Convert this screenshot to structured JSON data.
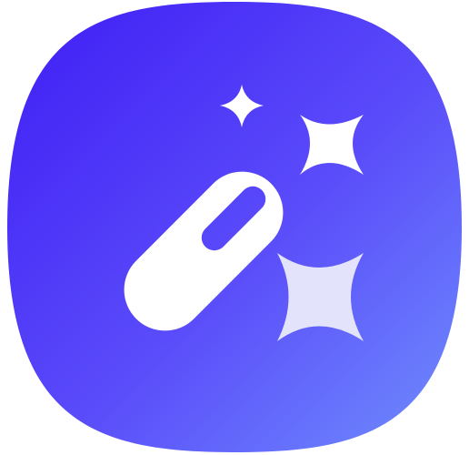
{
  "app_icon": {
    "icon": "magic-wand-with-sparkles-icon",
    "colors": {
      "gradient_start": "#3f1df5",
      "gradient_mid": "#5a4cfa",
      "gradient_end": "#6f8efd",
      "glyph": "#ffffff",
      "sparkle_faded": "#e3e3fb"
    }
  }
}
